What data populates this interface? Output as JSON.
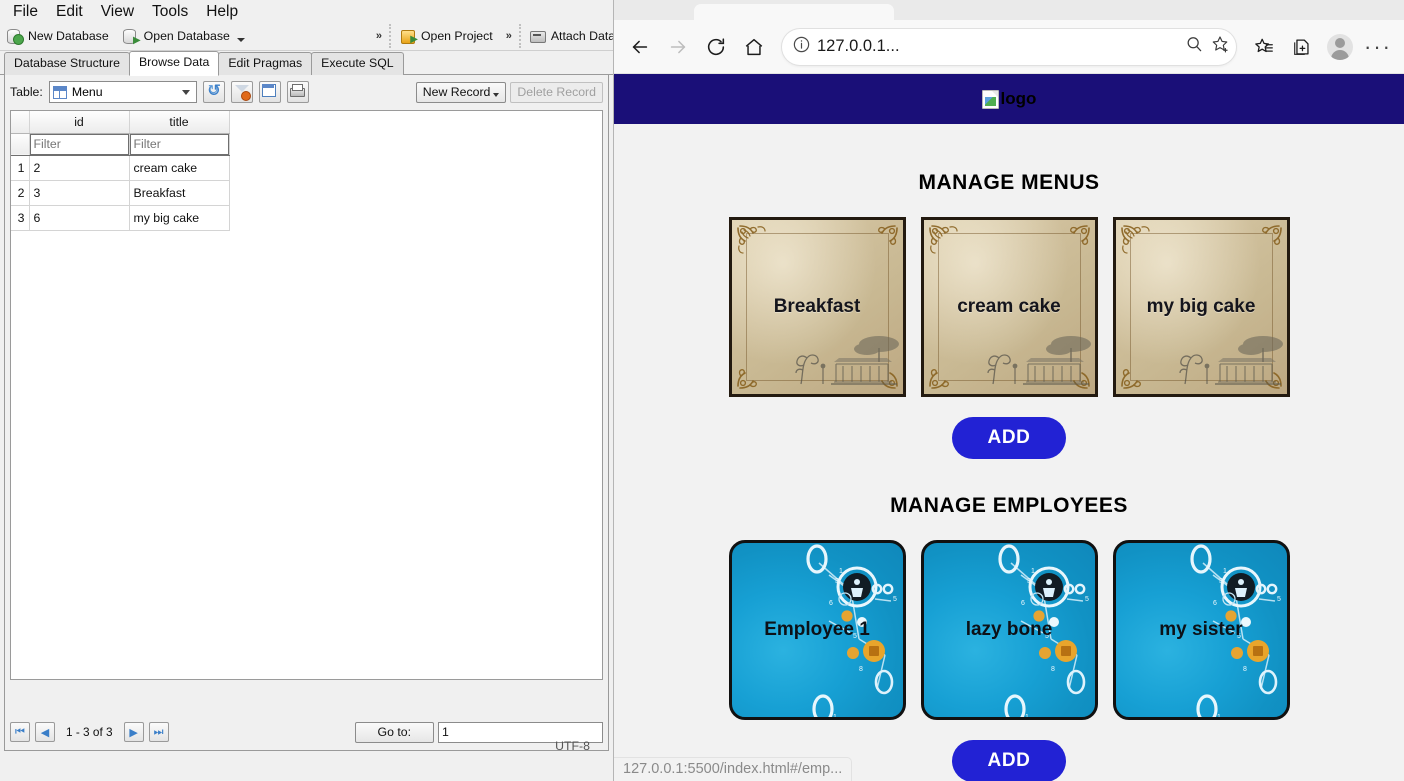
{
  "db_app": {
    "menubar": [
      "File",
      "Edit",
      "View",
      "Tools",
      "Help"
    ],
    "toolbar": {
      "new_database": "New Database",
      "open_database": "Open Database",
      "open_project": "Open Project",
      "attach_database": "Attach Database",
      "overflow": "»"
    },
    "tabs": [
      {
        "label": "Database Structure",
        "active": false
      },
      {
        "label": "Browse Data",
        "active": true
      },
      {
        "label": "Edit Pragmas",
        "active": false
      },
      {
        "label": "Execute SQL",
        "active": false
      }
    ],
    "table_bar": {
      "label": "Table:",
      "selected_table": "Menu",
      "new_record": "New Record",
      "delete_record": "Delete Record",
      "icon_refresh": "refresh-icon",
      "icon_filter": "clear-filter-icon",
      "icon_save": "save-results-icon",
      "icon_print": "print-icon"
    },
    "grid": {
      "columns": [
        "id",
        "title"
      ],
      "filter_placeholder": "Filter",
      "rows": [
        {
          "n": "1",
          "id": "2",
          "title": "cream cake"
        },
        {
          "n": "2",
          "id": "3",
          "title": "Breakfast"
        },
        {
          "n": "3",
          "id": "6",
          "title": "my big cake"
        }
      ]
    },
    "pager": {
      "range_text": "1 - 3 of 3",
      "goto_label": "Go to:",
      "goto_value": "1",
      "first": "first-page-icon",
      "prev": "previous-page-icon",
      "next": "next-page-icon",
      "last": "last-page-icon"
    },
    "statusbar": {
      "encoding": "UTF-8"
    }
  },
  "browser": {
    "chrome": {
      "back": "back-arrow-icon",
      "forward": "forward-arrow-icon",
      "refresh": "reload-icon",
      "home": "home-icon",
      "site_info": "info-icon",
      "url": "127.0.0.1...",
      "zoom_out": "zoom-out-icon",
      "favorite": "add-favorite-icon",
      "favorites": "favorites-icon",
      "collections": "collections-icon",
      "profile": "profile-avatar",
      "settings": "settings-and-more-icon"
    },
    "status_popup": "127.0.0.1:5500/index.html#/emp..."
  },
  "page": {
    "header": {
      "logo_alt": "logo",
      "logo_bg": "#1a0f78"
    },
    "menus": {
      "title": "MANAGE MENUS",
      "cards": [
        {
          "title": "Breakfast"
        },
        {
          "title": "cream cake"
        },
        {
          "title": "my big cake"
        }
      ],
      "add_label": "ADD"
    },
    "employees": {
      "title": "MANAGE EMPLOYEES",
      "cards": [
        {
          "title": "Employee 1"
        },
        {
          "title": "lazy bone"
        },
        {
          "title": "my sister"
        }
      ],
      "add_label": "ADD"
    },
    "colors": {
      "accent": "#2222d4",
      "header": "#1a0f78",
      "page_bg": "#f2f2f2"
    }
  }
}
